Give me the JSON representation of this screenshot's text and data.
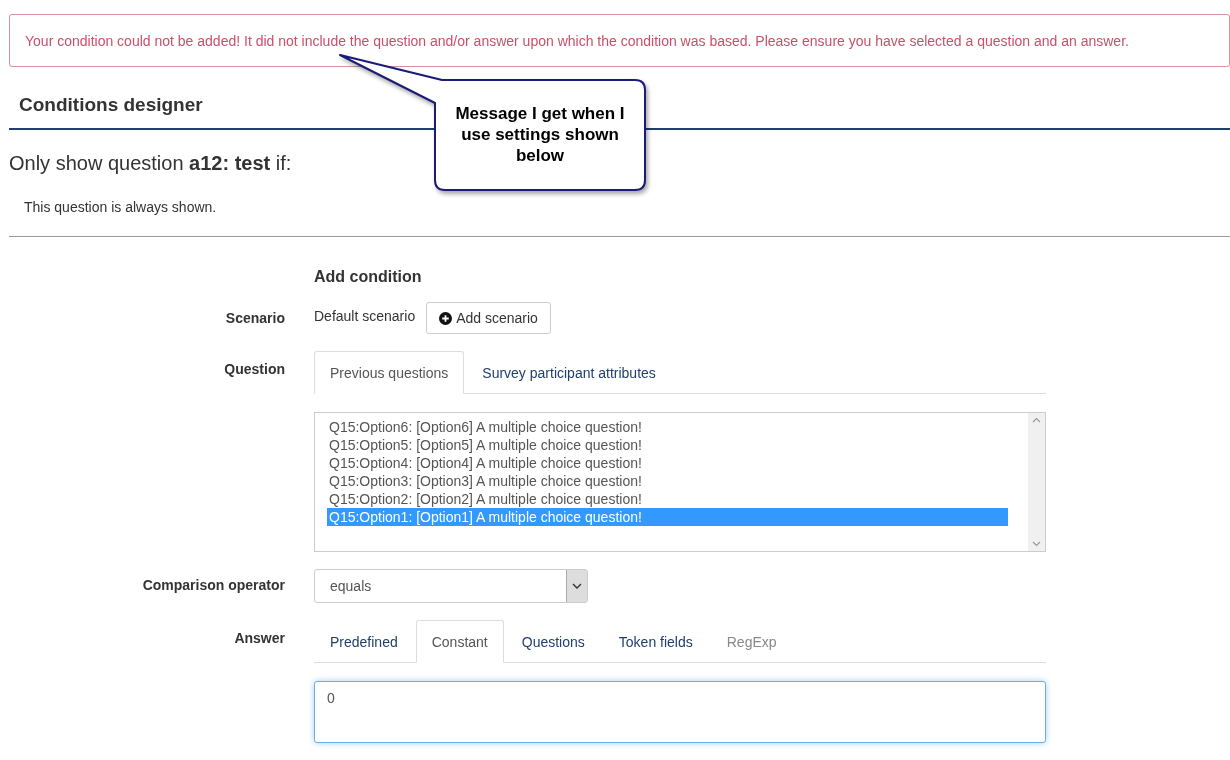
{
  "alert": {
    "message": "Your condition could not be added! It did not include the question and/or answer upon which the condition was based. Please ensure you have selected a question and an answer."
  },
  "callout": {
    "text": "Message I get when I use settings shown below"
  },
  "heading": "Conditions designer",
  "intro": "Only show question **a12: test** if:",
  "status": "This question is always shown.",
  "form": {
    "title": "Add condition",
    "scenario": {
      "label": "Scenario",
      "value": "Default scenario",
      "button": "Add scenario"
    },
    "question": {
      "label": "Question",
      "tabs": [
        {
          "label": "Previous questions",
          "selected": true
        },
        {
          "label": "Survey participant attributes",
          "selected": false
        }
      ],
      "options": [
        {
          "text": "Q15:Option6: [Option6] A multiple choice question!",
          "selected": false
        },
        {
          "text": "Q15:Option5: [Option5] A multiple choice question!",
          "selected": false
        },
        {
          "text": "Q15:Option4: [Option4] A multiple choice question!",
          "selected": false
        },
        {
          "text": "Q15:Option3: [Option3] A multiple choice question!",
          "selected": false
        },
        {
          "text": "Q15:Option2: [Option2] A multiple choice question!",
          "selected": false
        },
        {
          "text": "Q15:Option1: [Option1] A multiple choice question!",
          "selected": true
        }
      ]
    },
    "operator": {
      "label": "Comparison operator",
      "value": "equals"
    },
    "answer": {
      "label": "Answer",
      "tabs": [
        {
          "label": "Predefined",
          "selected": false,
          "disabled": false
        },
        {
          "label": "Constant",
          "selected": true,
          "disabled": false
        },
        {
          "label": "Questions",
          "selected": false,
          "disabled": false
        },
        {
          "label": "Token fields",
          "selected": false,
          "disabled": false
        },
        {
          "label": "RegExp",
          "selected": false,
          "disabled": true
        }
      ],
      "value": "0"
    }
  }
}
